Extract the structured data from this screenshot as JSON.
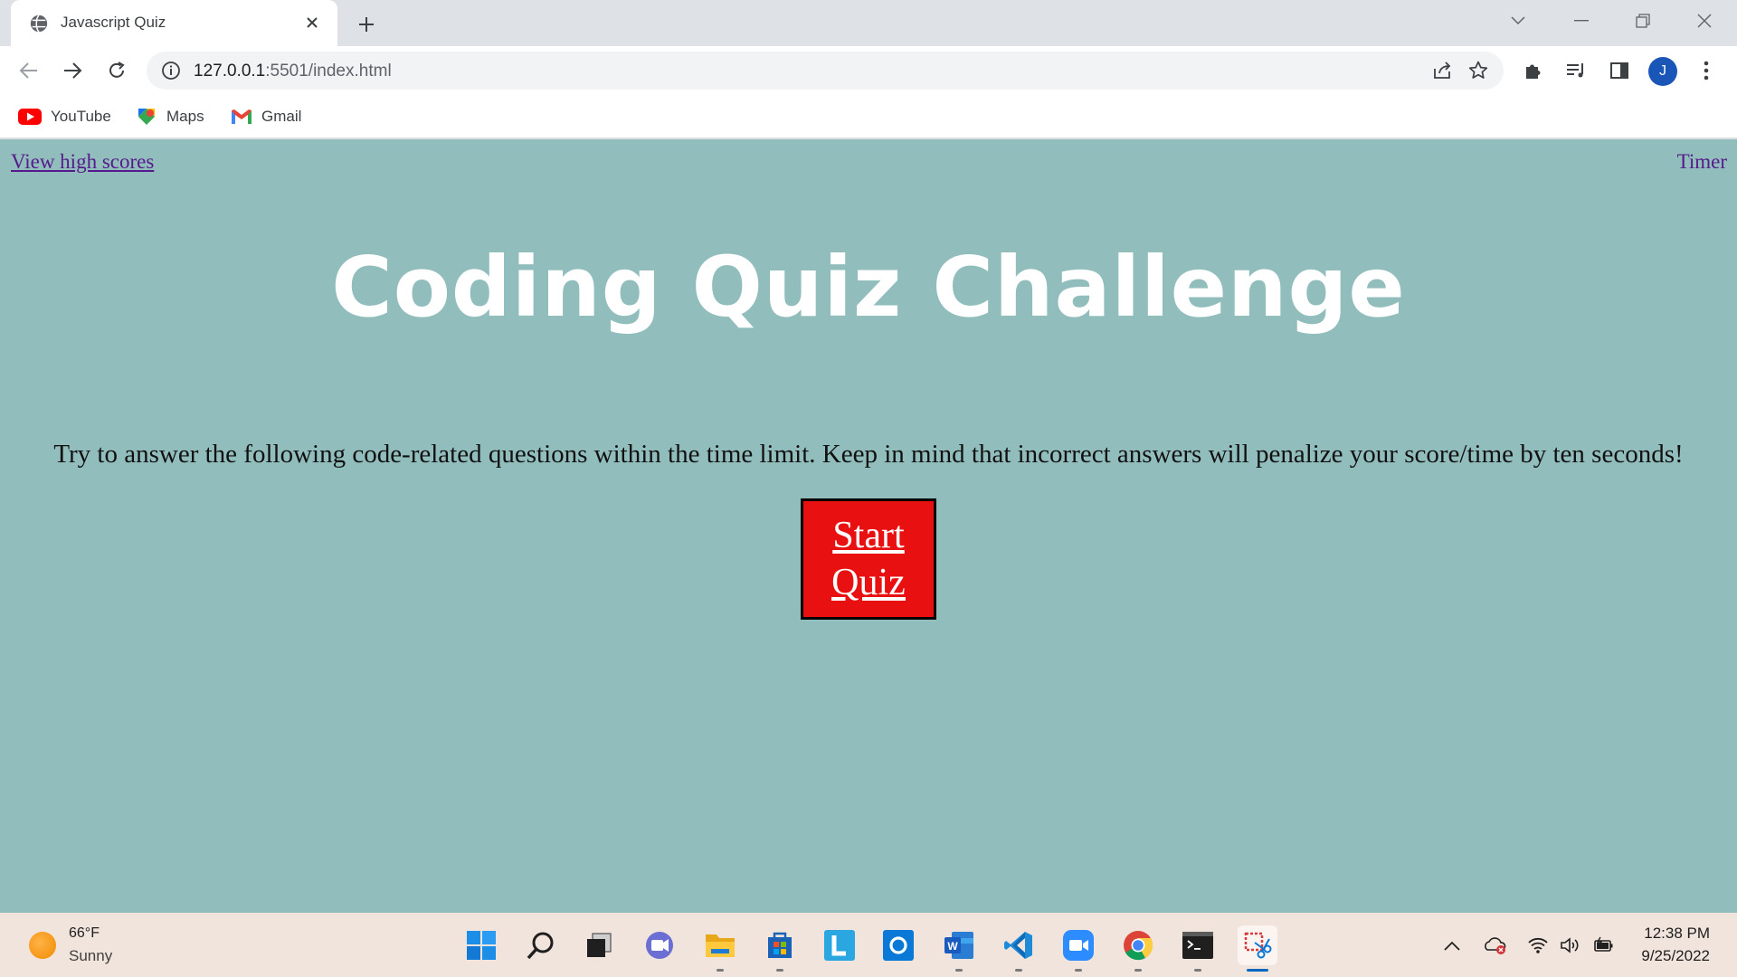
{
  "browser": {
    "tab": {
      "title": "Javascript Quiz"
    },
    "url": {
      "host": "127.0.0.1",
      "rest": ":5501/index.html"
    },
    "profile_initial": "J",
    "bookmarks": [
      {
        "label": "YouTube",
        "icon": "youtube-icon"
      },
      {
        "label": "Maps",
        "icon": "maps-icon"
      },
      {
        "label": "Gmail",
        "icon": "gmail-icon"
      }
    ]
  },
  "page": {
    "high_scores_link": "View high scores",
    "timer_label": "Timer",
    "title": "Coding Quiz Challenge",
    "intro": "Try to answer the following code-related questions within the time limit. Keep in mind that incorrect answers will penalize your score/time by ten seconds!",
    "start_button": {
      "line1": "Start",
      "line2": "Quiz"
    },
    "colors": {
      "background": "#91bdbc",
      "start_button": "#e81010",
      "title": "#ffffff"
    }
  },
  "taskbar": {
    "weather": {
      "temp": "66°F",
      "condition": "Sunny"
    },
    "apps": [
      "windows-start",
      "search",
      "task-view",
      "teams-chat",
      "file-explorer",
      "microsoft-store",
      "lexilogos-app",
      "cortana",
      "word",
      "vscode",
      "zoom",
      "chrome",
      "terminal",
      "snipping-tool"
    ],
    "clock": {
      "time": "12:38 PM",
      "date": "9/25/2022"
    }
  }
}
